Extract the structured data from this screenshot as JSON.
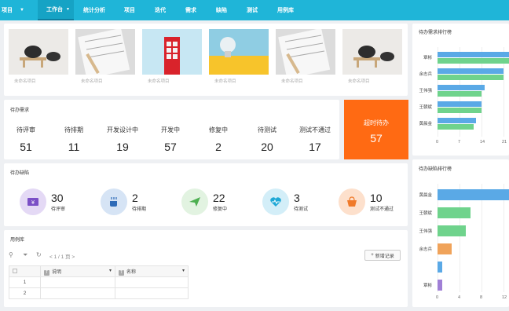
{
  "nav": {
    "brand": "项目",
    "items": [
      {
        "label": "工作台",
        "active": true
      },
      {
        "label": "统计分析"
      },
      {
        "label": "项目"
      },
      {
        "label": "迭代"
      },
      {
        "label": "需求"
      },
      {
        "label": "缺陷"
      },
      {
        "label": "测试"
      },
      {
        "label": "用例库"
      }
    ]
  },
  "projects": [
    {
      "caption": "未命名项目"
    },
    {
      "caption": "未命名项目"
    },
    {
      "caption": "未命名项目"
    },
    {
      "caption": "未命名项目"
    },
    {
      "caption": "未命名项目"
    },
    {
      "caption": "未命名项目"
    }
  ],
  "demands": {
    "title": "待办需求",
    "stats": [
      {
        "label": "待评审",
        "value": "51"
      },
      {
        "label": "待排期",
        "value": "11"
      },
      {
        "label": "开发设计中",
        "value": "19"
      },
      {
        "label": "开发中",
        "value": "57"
      },
      {
        "label": "修复中",
        "value": "2"
      },
      {
        "label": "待测试",
        "value": "20"
      },
      {
        "label": "测试不通过",
        "value": "17"
      }
    ],
    "overdue": {
      "label": "超时待办",
      "value": "57"
    }
  },
  "bugs": {
    "title": "待办缺陷",
    "stats": [
      {
        "label": "待评审",
        "value": "30",
        "icon": "ticket-icon",
        "color": "#7b4fc6",
        "bg": "#e4d9f5"
      },
      {
        "label": "待排期",
        "value": "2",
        "icon": "coffee-icon",
        "color": "#2e6bb8",
        "bg": "#d6e4f5"
      },
      {
        "label": "修复中",
        "value": "22",
        "icon": "paper-plane-icon",
        "color": "#4caf50",
        "bg": "#e2f3e1"
      },
      {
        "label": "待测试",
        "value": "3",
        "icon": "heartbeat-icon",
        "color": "#1ea8d6",
        "bg": "#d3eef8"
      },
      {
        "label": "测试不通过",
        "value": "10",
        "icon": "basket-icon",
        "color": "#f07a2a",
        "bg": "#fde0cc"
      }
    ]
  },
  "cases": {
    "title": "用例库",
    "pagination": "< 1 / 1 页 >",
    "add_label": "新增记录",
    "columns": [
      "说明",
      "名称"
    ],
    "rows": [
      {
        "index": "1"
      },
      {
        "index": "2"
      }
    ]
  },
  "colors": {
    "accent": "#1fb5d8",
    "overdue": "#ff6a13"
  },
  "chart_data": [
    {
      "type": "bar",
      "title": "待办需求排行榜",
      "orientation": "horizontal",
      "categories": [
        "覃彬",
        "余志兵",
        "王伟强",
        "王朝斌",
        "黄晨金"
      ],
      "series": [
        {
          "color": "#5aa9e6",
          "values": [
            27,
            24,
            17,
            16,
            14
          ]
        },
        {
          "color": "#6fd38c",
          "values": [
            26,
            24,
            16,
            16,
            13
          ]
        }
      ],
      "xticks": [
        "0",
        "7",
        "14",
        "21"
      ]
    },
    {
      "type": "bar",
      "title": "待办缺陷排行榜",
      "orientation": "horizontal",
      "categories": [
        "黄晨金",
        "王朝斌",
        "王伟强",
        "余志兵",
        "",
        "覃彬"
      ],
      "values": [
        16,
        7,
        6,
        3,
        1,
        1
      ],
      "colors": [
        "#5aa9e6",
        "#6fd38c",
        "#6fd38c",
        "#f0a35a",
        "#5aa9e6",
        "#a07fd6"
      ],
      "xticks": [
        "0",
        "4",
        "8",
        "12"
      ]
    }
  ]
}
